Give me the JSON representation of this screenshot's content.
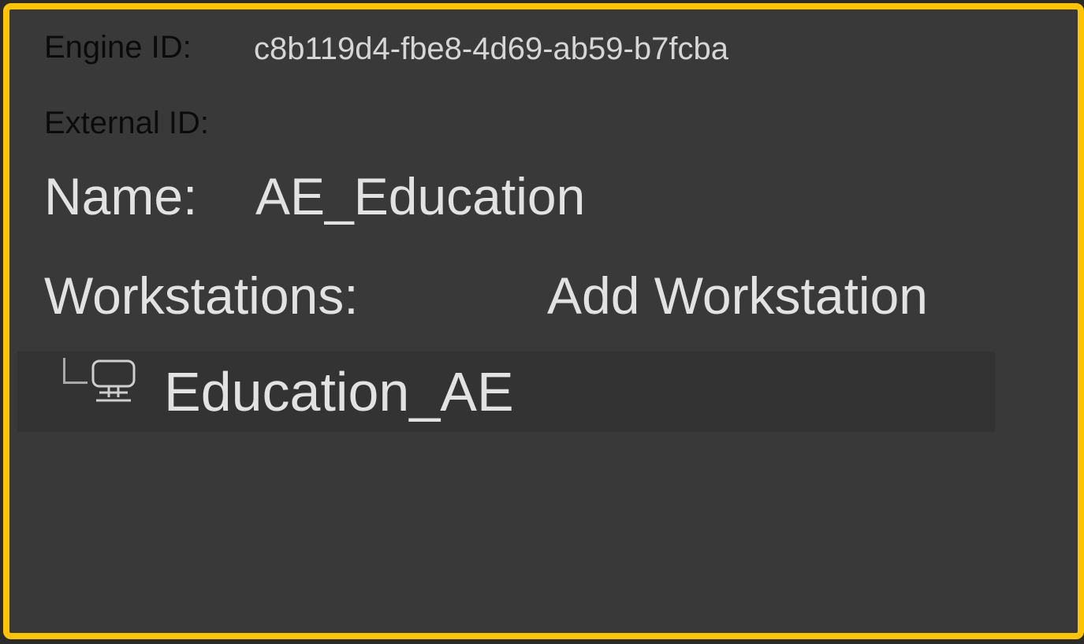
{
  "engine": {
    "label": "Engine ID:",
    "value": "c8b119d4-fbe8-4d69-ab59-b7fcba"
  },
  "external": {
    "label": "External ID:",
    "value": ""
  },
  "name": {
    "label": "Name:",
    "value": "AE_Education"
  },
  "workstations": {
    "label": "Workstations:",
    "add_label": "Add Workstation",
    "items": [
      {
        "label": "Education_AE",
        "icon": "workstation-icon"
      }
    ]
  },
  "colors": {
    "frame_border": "#ffc400",
    "panel_bg": "#393939",
    "row_bg": "#333333",
    "text_light": "#e2e2e2",
    "text_dark": "#0b0b0b"
  }
}
